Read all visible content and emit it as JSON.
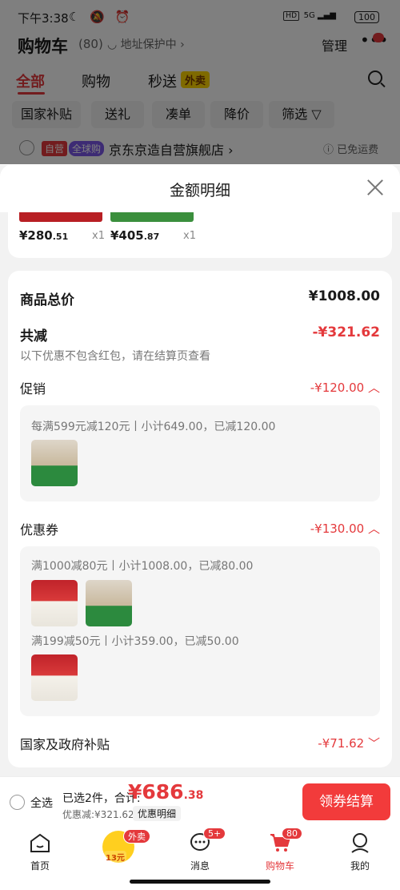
{
  "status_bar": {
    "time": "下午3:38",
    "network": "5G",
    "hd": "HD",
    "battery": "100"
  },
  "header": {
    "title": "购物车",
    "count": "(80)",
    "address_protect": "地址保护中",
    "manage": "管理"
  },
  "tabs": [
    {
      "label": "全部"
    },
    {
      "label": "购物"
    },
    {
      "label": "秒送"
    }
  ],
  "tab_badge": "外卖",
  "filter_chips": [
    {
      "label": "国家补贴"
    },
    {
      "label": "送礼"
    },
    {
      "label": "凑单"
    },
    {
      "label": "降价"
    },
    {
      "label": "筛选"
    }
  ],
  "store": {
    "tag_self": "自营",
    "tag_global": "全球购",
    "name": "京东京造自营旗舰店",
    "shipping": "已免运费"
  },
  "sheet": {
    "title": "金额明细",
    "products": [
      {
        "price_int": "¥280",
        "price_dec": ".51",
        "qty": "x1"
      },
      {
        "price_int": "¥405",
        "price_dec": ".87",
        "qty": "x1"
      }
    ],
    "total_label": "商品总价",
    "total_value": "¥1008.00",
    "reduce_label": "共减",
    "reduce_value": "-¥321.62",
    "reduce_note": "以下优惠不包含红包，请在结算页查看",
    "promo_label": "促销",
    "promo_value": "-¥120.00",
    "promo_line": "每满599元减120元丨小计649.00，已减120.00",
    "coupon_label": "优惠券",
    "coupon_value": "-¥130.00",
    "coupon_line1": "满1000减80元丨小计1008.00，已减80.00",
    "coupon_line2": "满199减50元丨小计359.00，已减50.00",
    "subsidy_label": "国家及政府补贴",
    "subsidy_value": "-¥71.62"
  },
  "bottom": {
    "select_all": "全选",
    "selected_info": "已选2件，合计:",
    "total_int": "¥686",
    "total_dec": ".38",
    "discount": "优惠减:¥321.62",
    "detail_button": "优惠明细",
    "checkout": "领券结算"
  },
  "nav": {
    "items": [
      {
        "label": "首页"
      },
      {
        "label": ""
      },
      {
        "label": "消息"
      },
      {
        "label": "购物车"
      },
      {
        "label": "我的"
      }
    ],
    "waimai_badge": "外卖",
    "coupon_badge": "13元",
    "msg_badge": "5+",
    "cart_badge": "80"
  },
  "colors": {
    "accent": "#e4393c",
    "checkout": "#f23b3b",
    "waimai": "#ffd400"
  }
}
